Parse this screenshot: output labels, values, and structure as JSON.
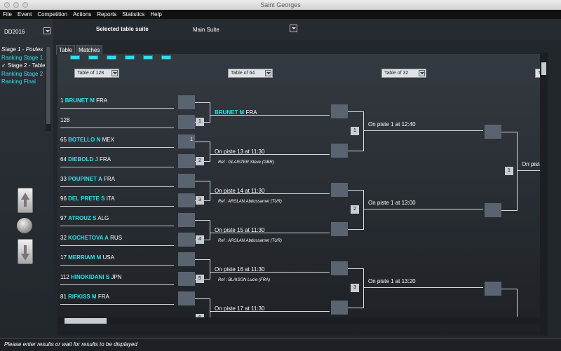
{
  "window": {
    "title": "Saint Georges"
  },
  "menu": [
    "File",
    "Event",
    "Competition",
    "Actions",
    "Reports",
    "Statistics",
    "Help"
  ],
  "left": {
    "event": "DD2016",
    "stages": [
      {
        "label": "Stage 1 - Poules",
        "style": "header"
      },
      {
        "label": "Ranking Stage 1 -",
        "style": "cyan"
      },
      {
        "label": "✓ Stage 2 - Table",
        "style": "current"
      },
      {
        "label": "Ranking Stage 2 -",
        "style": "cyan"
      },
      {
        "label": "Ranking Final",
        "style": "cyan"
      }
    ]
  },
  "suite": {
    "label": "Selected table suite",
    "value": "Main Suite"
  },
  "tabs": [
    {
      "label": "Table",
      "active": false
    },
    {
      "label": "Matches",
      "active": true
    }
  ],
  "rounds": [
    "Table of 128",
    "Table of 64",
    "Table of 32",
    "Ta"
  ],
  "entries": [
    {
      "seed": "1",
      "name": "BRUNET M",
      "nat": "FRA"
    },
    {
      "seed": "128",
      "name": "",
      "nat": ""
    },
    {
      "seed": "65",
      "name": "BOTELLO N",
      "nat": "MEX"
    },
    {
      "seed": "64",
      "name": "DIEBOLD J",
      "nat": "FRA"
    },
    {
      "seed": "33",
      "name": "POUPINET A",
      "nat": "FRA"
    },
    {
      "seed": "96",
      "name": "DEL PRETE S",
      "nat": "ITA"
    },
    {
      "seed": "97",
      "name": "ATROUZ S",
      "nat": "ALG"
    },
    {
      "seed": "32",
      "name": "KOCHETOVA A",
      "nat": "RUS"
    },
    {
      "seed": "17",
      "name": "MERRIAM M",
      "nat": "USA"
    },
    {
      "seed": "112",
      "name": "HINOKIDANI S",
      "nat": "JPN"
    },
    {
      "seed": "81",
      "name": "RIFKISS M",
      "nat": "FRA"
    }
  ],
  "r1_scores": [
    "",
    "",
    "1",
    "",
    "",
    "",
    "",
    "",
    "",
    "",
    ""
  ],
  "r1_matches": [
    "1",
    "2",
    "3",
    "4",
    "5",
    "6"
  ],
  "r2_matches": [
    {
      "winner_name": "BRUNET M",
      "winner_nat": "FRA",
      "info": "",
      "ref": ""
    },
    {
      "winner_name": "",
      "winner_nat": "",
      "info": "On piste 13 at 11:30",
      "ref": "Ref : GLAISTER Steve (GBR)"
    },
    {
      "winner_name": "",
      "winner_nat": "",
      "info": "On piste 14 at 11:30",
      "ref": "Ref : ARSLAN Abdussamet (TUR)"
    },
    {
      "winner_name": "",
      "winner_nat": "",
      "info": "On piste 15 at 11:30",
      "ref": "Ref : ARSLAN Abdussamet (TUR)"
    },
    {
      "winner_name": "",
      "winner_nat": "",
      "info": "On piste 16 at 11:30",
      "ref": "Ref : BLAISON Lucie (FRA)"
    },
    {
      "winner_name": "",
      "winner_nat": "",
      "info": "On piste 17 at 11:30",
      "ref": ""
    }
  ],
  "r3_matches": [
    {
      "num": "1",
      "info": "On piste 1 at 12:40"
    },
    {
      "num": "2",
      "info": "On piste 1 at 13:00"
    },
    {
      "num": "3",
      "info": "On piste 1 at 13:20"
    }
  ],
  "r4_matches": [
    {
      "num": "1",
      "info": "On piste"
    }
  ],
  "status": "Please enter results or wait for results to be displayed",
  "colors": {
    "accent": "#2fe0ea",
    "background": "#2a2f35"
  }
}
